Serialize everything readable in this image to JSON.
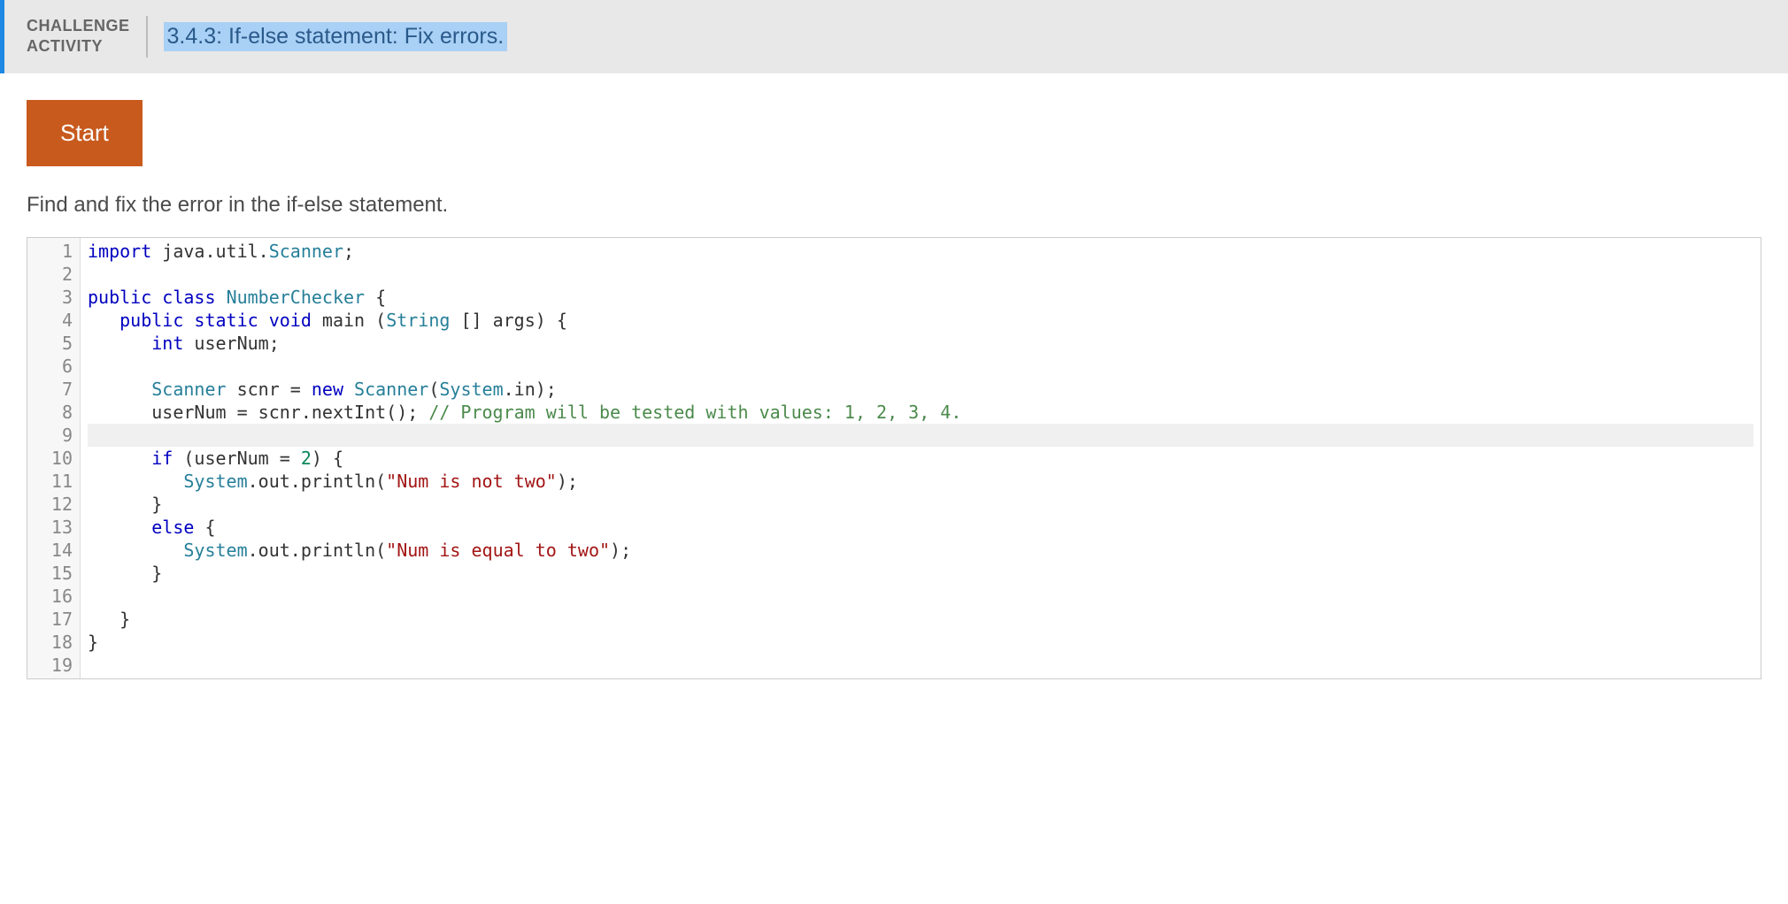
{
  "header": {
    "challenge_label_line1": "CHALLENGE",
    "challenge_label_line2": "ACTIVITY",
    "title": "3.4.3: If-else statement: Fix errors."
  },
  "content": {
    "start_button": "Start",
    "prompt": "Find and fix the error in the if-else statement."
  },
  "editor": {
    "active_line": 9,
    "lines": [
      {
        "num": 1,
        "tokens": [
          {
            "t": "import",
            "c": "tok-keyword"
          },
          {
            "t": " java.util.",
            "c": "tok-plain"
          },
          {
            "t": "Scanner",
            "c": "tok-classname"
          },
          {
            "t": ";",
            "c": "tok-plain"
          }
        ]
      },
      {
        "num": 2,
        "tokens": []
      },
      {
        "num": 3,
        "tokens": [
          {
            "t": "public",
            "c": "tok-keyword"
          },
          {
            "t": " ",
            "c": "tok-plain"
          },
          {
            "t": "class",
            "c": "tok-keyword"
          },
          {
            "t": " ",
            "c": "tok-plain"
          },
          {
            "t": "NumberChecker",
            "c": "tok-classname"
          },
          {
            "t": " {",
            "c": "tok-plain"
          }
        ]
      },
      {
        "num": 4,
        "tokens": [
          {
            "t": "   ",
            "c": "tok-plain"
          },
          {
            "t": "public",
            "c": "tok-keyword"
          },
          {
            "t": " ",
            "c": "tok-plain"
          },
          {
            "t": "static",
            "c": "tok-keyword"
          },
          {
            "t": " ",
            "c": "tok-plain"
          },
          {
            "t": "void",
            "c": "tok-keyword"
          },
          {
            "t": " main (",
            "c": "tok-plain"
          },
          {
            "t": "String",
            "c": "tok-classname"
          },
          {
            "t": " [] args) {",
            "c": "tok-plain"
          }
        ]
      },
      {
        "num": 5,
        "tokens": [
          {
            "t": "      ",
            "c": "tok-plain"
          },
          {
            "t": "int",
            "c": "tok-keyword"
          },
          {
            "t": " userNum;",
            "c": "tok-plain"
          }
        ]
      },
      {
        "num": 6,
        "tokens": []
      },
      {
        "num": 7,
        "tokens": [
          {
            "t": "      ",
            "c": "tok-plain"
          },
          {
            "t": "Scanner",
            "c": "tok-classname"
          },
          {
            "t": " scnr = ",
            "c": "tok-plain"
          },
          {
            "t": "new",
            "c": "tok-keyword"
          },
          {
            "t": " ",
            "c": "tok-plain"
          },
          {
            "t": "Scanner",
            "c": "tok-classname"
          },
          {
            "t": "(",
            "c": "tok-plain"
          },
          {
            "t": "System",
            "c": "tok-classname"
          },
          {
            "t": ".in);",
            "c": "tok-plain"
          }
        ]
      },
      {
        "num": 8,
        "tokens": [
          {
            "t": "      userNum = scnr.nextInt(); ",
            "c": "tok-plain"
          },
          {
            "t": "// Program will be tested with values: 1, 2, 3, 4.",
            "c": "tok-comment"
          }
        ]
      },
      {
        "num": 9,
        "tokens": []
      },
      {
        "num": 10,
        "tokens": [
          {
            "t": "      ",
            "c": "tok-plain"
          },
          {
            "t": "if",
            "c": "tok-keyword"
          },
          {
            "t": " (userNum = ",
            "c": "tok-plain"
          },
          {
            "t": "2",
            "c": "tok-number"
          },
          {
            "t": ") {",
            "c": "tok-plain"
          }
        ]
      },
      {
        "num": 11,
        "tokens": [
          {
            "t": "         ",
            "c": "tok-plain"
          },
          {
            "t": "System",
            "c": "tok-classname"
          },
          {
            "t": ".out.println(",
            "c": "tok-plain"
          },
          {
            "t": "\"Num is not two\"",
            "c": "tok-string"
          },
          {
            "t": ");",
            "c": "tok-plain"
          }
        ]
      },
      {
        "num": 12,
        "tokens": [
          {
            "t": "      }",
            "c": "tok-plain"
          }
        ]
      },
      {
        "num": 13,
        "tokens": [
          {
            "t": "      ",
            "c": "tok-plain"
          },
          {
            "t": "else",
            "c": "tok-keyword"
          },
          {
            "t": " {",
            "c": "tok-plain"
          }
        ]
      },
      {
        "num": 14,
        "tokens": [
          {
            "t": "         ",
            "c": "tok-plain"
          },
          {
            "t": "System",
            "c": "tok-classname"
          },
          {
            "t": ".out.println(",
            "c": "tok-plain"
          },
          {
            "t": "\"Num is equal to two\"",
            "c": "tok-string"
          },
          {
            "t": ");",
            "c": "tok-plain"
          }
        ]
      },
      {
        "num": 15,
        "tokens": [
          {
            "t": "      }",
            "c": "tok-plain"
          }
        ]
      },
      {
        "num": 16,
        "tokens": []
      },
      {
        "num": 17,
        "tokens": [
          {
            "t": "   }",
            "c": "tok-plain"
          }
        ]
      },
      {
        "num": 18,
        "tokens": [
          {
            "t": "}",
            "c": "tok-plain"
          }
        ]
      },
      {
        "num": 19,
        "tokens": []
      }
    ]
  }
}
